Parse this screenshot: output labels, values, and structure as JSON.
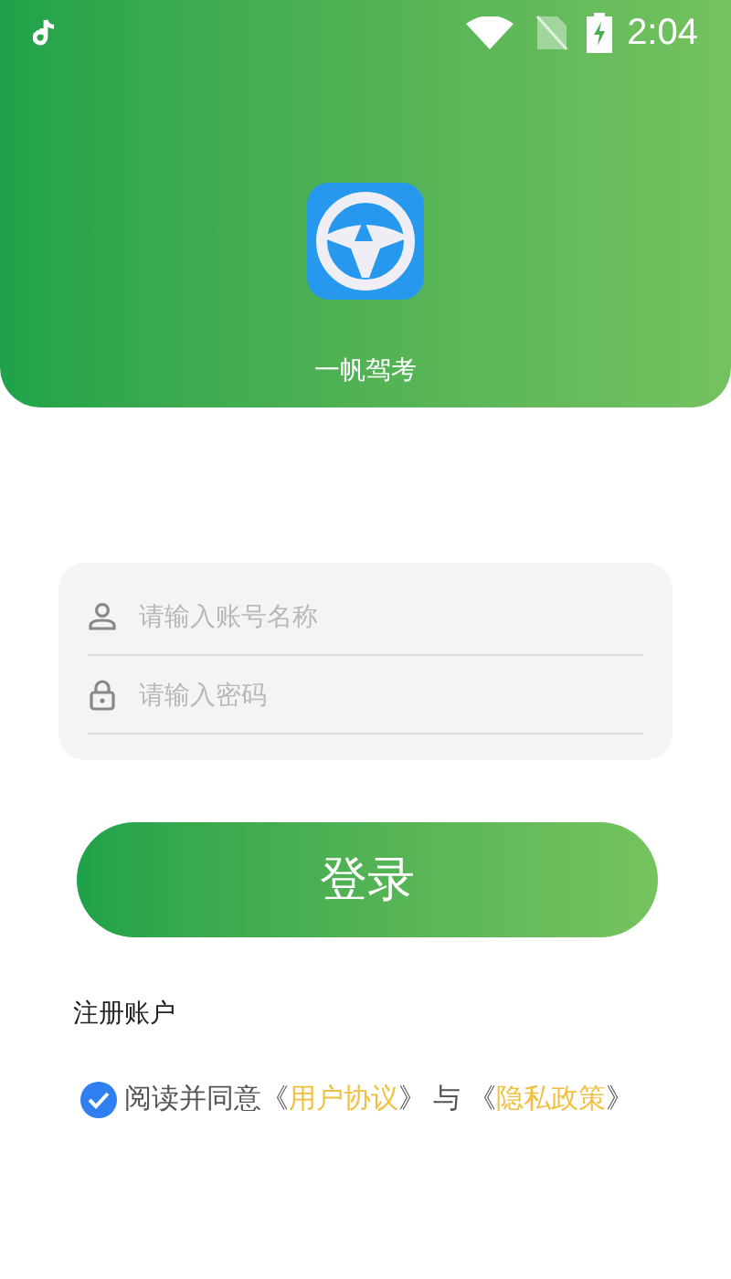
{
  "status_bar": {
    "time": "2:04"
  },
  "app": {
    "name": "一帆驾考"
  },
  "form": {
    "fields": [
      {
        "kind": "user",
        "placeholder": "请输入账号名称"
      },
      {
        "kind": "lock",
        "placeholder": "请输入密码"
      }
    ]
  },
  "login_button": {
    "label": "登录"
  },
  "register_link": {
    "label": "注册账户"
  },
  "agreement": {
    "checked": true,
    "parts": [
      {
        "kind": "text",
        "text": "阅读并同意《"
      },
      {
        "kind": "link",
        "text": "用户协议"
      },
      {
        "kind": "text",
        "text": "》 与 《"
      },
      {
        "kind": "link",
        "text": "隐私政策"
      },
      {
        "kind": "text",
        "text": "》"
      }
    ]
  }
}
